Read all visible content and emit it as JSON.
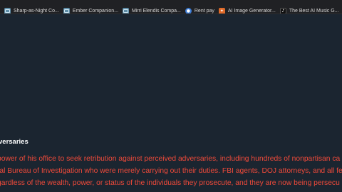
{
  "bookmarks_bar": {
    "items": [
      {
        "label": "Sharp-as-Night Co...",
        "icon": "globe-icon"
      },
      {
        "label": "Ember Companion...",
        "icon": "globe-icon"
      },
      {
        "label": "Mirri Elendis Compa...",
        "icon": "globe-icon"
      },
      {
        "label": "Rent pay",
        "icon": "circle-icon"
      },
      {
        "label": "AI Image Generator...",
        "icon": "ai-icon"
      },
      {
        "label": "The Best AI Music G...",
        "icon": "music-icon"
      }
    ]
  },
  "article": {
    "heading": "versaries",
    "lines": [
      "power of his office to seek retribution against perceived adversaries, including hundreds of nonpartisan ca",
      "ral Bureau of Investigation who were merely carrying out their duties. FBI agents, DOJ attorneys, and all fe",
      "gardless of the wealth, power, or status of the individuals they prosecute, and they are now being persecu"
    ]
  },
  "colors": {
    "page_background": "#1b2530",
    "bookmarks_background": "#202124",
    "heading_text": "#ffffff",
    "body_text": "#f04a3a"
  }
}
